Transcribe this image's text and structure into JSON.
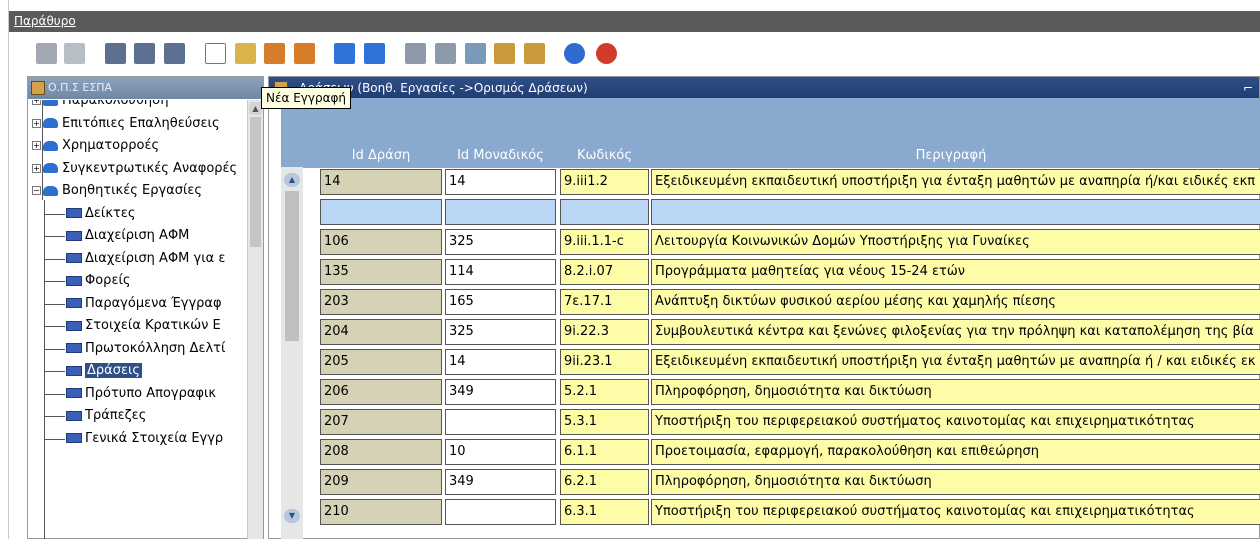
{
  "menubar": {
    "label": "Παράθυρο"
  },
  "toolbar": {
    "buttons": [
      {
        "name": "save-icon",
        "color": "#7a8594",
        "disabled": true
      },
      {
        "name": "check-icon",
        "color": "#9aa3ad",
        "disabled": true
      },
      {
        "name": "record-prev-icon",
        "color": "#5d7090"
      },
      {
        "name": "record-clear-icon",
        "color": "#5d7090"
      },
      {
        "name": "record-next-icon",
        "color": "#5d7090"
      },
      {
        "name": "blank-page-icon",
        "color": "#ffffff"
      },
      {
        "name": "new-record-icon",
        "color": "#d8b44a"
      },
      {
        "name": "insert-row-icon",
        "color": "#d77d2a"
      },
      {
        "name": "delete-row-icon",
        "color": "#d77d2a"
      },
      {
        "name": "arrow-up-icon",
        "color": "#2e74d8"
      },
      {
        "name": "arrow-down-icon",
        "color": "#2e74d8"
      },
      {
        "name": "print-icon",
        "color": "#8c9aaa"
      },
      {
        "name": "print-preview-icon",
        "color": "#8c9aaa"
      },
      {
        "name": "edit-icon",
        "color": "#7a9ab9"
      },
      {
        "name": "copy-icon",
        "color": "#c99a3a"
      },
      {
        "name": "paste-icon",
        "color": "#c99a3a"
      },
      {
        "name": "help-icon",
        "color": "#2f6bd0"
      },
      {
        "name": "exit-icon",
        "color": "#d23a2a"
      }
    ]
  },
  "tooltip": {
    "text": "Νέα Εγγραφή"
  },
  "tree": {
    "title": "Ο.Π.Σ ΕΣΠΑ",
    "items": [
      {
        "label": "Παρακολούθηση",
        "type": "folder"
      },
      {
        "label": "Επιτόπιες Επαληθεύσεις",
        "type": "folder"
      },
      {
        "label": "Χρηματορροές",
        "type": "folder"
      },
      {
        "label": "Συγκεντρωτικές Αναφορές",
        "type": "folder"
      },
      {
        "label": "Βοηθητικές Εργασίες",
        "type": "folder-open"
      },
      {
        "label": "Δείκτες",
        "type": "leaf"
      },
      {
        "label": "Διαχείριση ΑΦΜ",
        "type": "leaf"
      },
      {
        "label": "Διαχείριση ΑΦΜ για ε",
        "type": "leaf"
      },
      {
        "label": "Φορείς",
        "type": "leaf"
      },
      {
        "label": "Παραγόμενα Έγγραφ",
        "type": "leaf"
      },
      {
        "label": "Στοιχεία Κρατικών Ε",
        "type": "leaf"
      },
      {
        "label": "Πρωτοκόλληση Δελτί",
        "type": "leaf"
      },
      {
        "label": "Δράσεις",
        "type": "leaf",
        "selected": true
      },
      {
        "label": "Πρότυπο Απογραφικ",
        "type": "leaf"
      },
      {
        "label": "Τράπεζες",
        "type": "leaf"
      },
      {
        "label": "Γενικά Στοιχεία Εγγρ",
        "type": "leaf"
      }
    ]
  },
  "main": {
    "title": "Δράσεων (Βοηθ. Εργασίες ->Ορισμός Δράσεων)",
    "minimize": "⌐",
    "columns": [
      "Id Δράση",
      "Id Μοναδικός",
      "Κωδικός",
      "Περιγραφή"
    ],
    "rows": [
      [
        "14",
        "14",
        "9.iii1.2",
        "Εξειδικευμένη εκπαιδευτική υποστήριξη για ένταξη μαθητών με αναπηρία ή/και ειδικές εκπ"
      ],
      [
        "",
        "",
        "",
        ""
      ],
      [
        "106",
        "325",
        "9.iii.1.1-c",
        "Λειτουργία Κοινωνικών Δομών Υποστήριξης για Γυναίκες"
      ],
      [
        "135",
        "114",
        "8.2.i.07",
        "Προγράμματα μαθητείας για νέους 15-24 ετών"
      ],
      [
        "203",
        "165",
        "7ε.17.1",
        "Ανάπτυξη δικτύων φυσικού αερίου μέσης και χαμηλής πίεσης"
      ],
      [
        "204",
        "325",
        "9i.22.3",
        "Συμβουλευτικά κέντρα και ξενώνες φιλοξενίας για την πρόληψη και καταπολέμηση της βία"
      ],
      [
        "205",
        "14",
        "9ii.23.1",
        "Εξειδικευμένη εκπαιδευτική υποστήριξη για ένταξη μαθητών με αναπηρία ή / και ειδικές εκ"
      ],
      [
        "206",
        "349",
        "5.2.1",
        "Πληροφόρηση, δημοσιότητα και δικτύωση"
      ],
      [
        "207",
        "",
        "5.3.1",
        "Υποστήριξη του περιφερειακού συστήματος καινοτομίας και επιχειρηματικότητας"
      ],
      [
        "208",
        "10",
        "6.1.1",
        "Προετοιμασία, εφαρμογή, παρακολούθηση και επιθεώρηση"
      ],
      [
        "209",
        "349",
        "6.2.1",
        "Πληροφόρηση, δημοσιότητα και δικτύωση"
      ],
      [
        "210",
        "",
        "6.3.1",
        "Υποστήριξη του περιφερειακού συστήματος καινοτομίας και επιχειρηματικότητας"
      ]
    ]
  }
}
